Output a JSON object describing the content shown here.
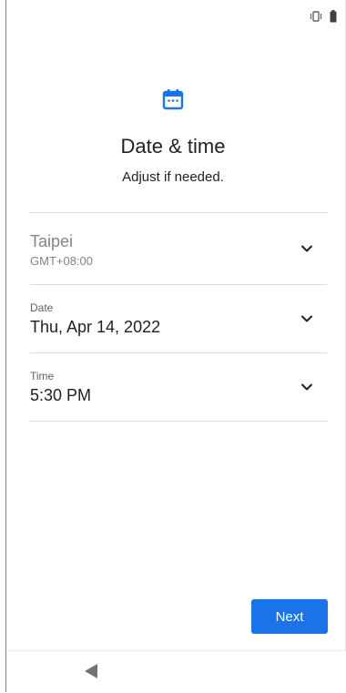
{
  "status_bar": {
    "icons": [
      "vibrate-icon",
      "battery-icon"
    ]
  },
  "header": {
    "icon": "calendar-icon",
    "title": "Date & time",
    "subtitle": "Adjust if needed."
  },
  "settings": {
    "timezone": {
      "name": "Taipei",
      "offset": "GMT+08:00"
    },
    "date": {
      "label": "Date",
      "value": "Thu, Apr 14, 2022"
    },
    "time": {
      "label": "Time",
      "value": "5:30 PM"
    }
  },
  "actions": {
    "next_label": "Next"
  },
  "nav": {
    "back_icon": "back-triangle-icon"
  },
  "colors": {
    "accent": "#1a73e8",
    "text": "#202124",
    "muted": "#80868b",
    "divider": "#dadce0"
  }
}
